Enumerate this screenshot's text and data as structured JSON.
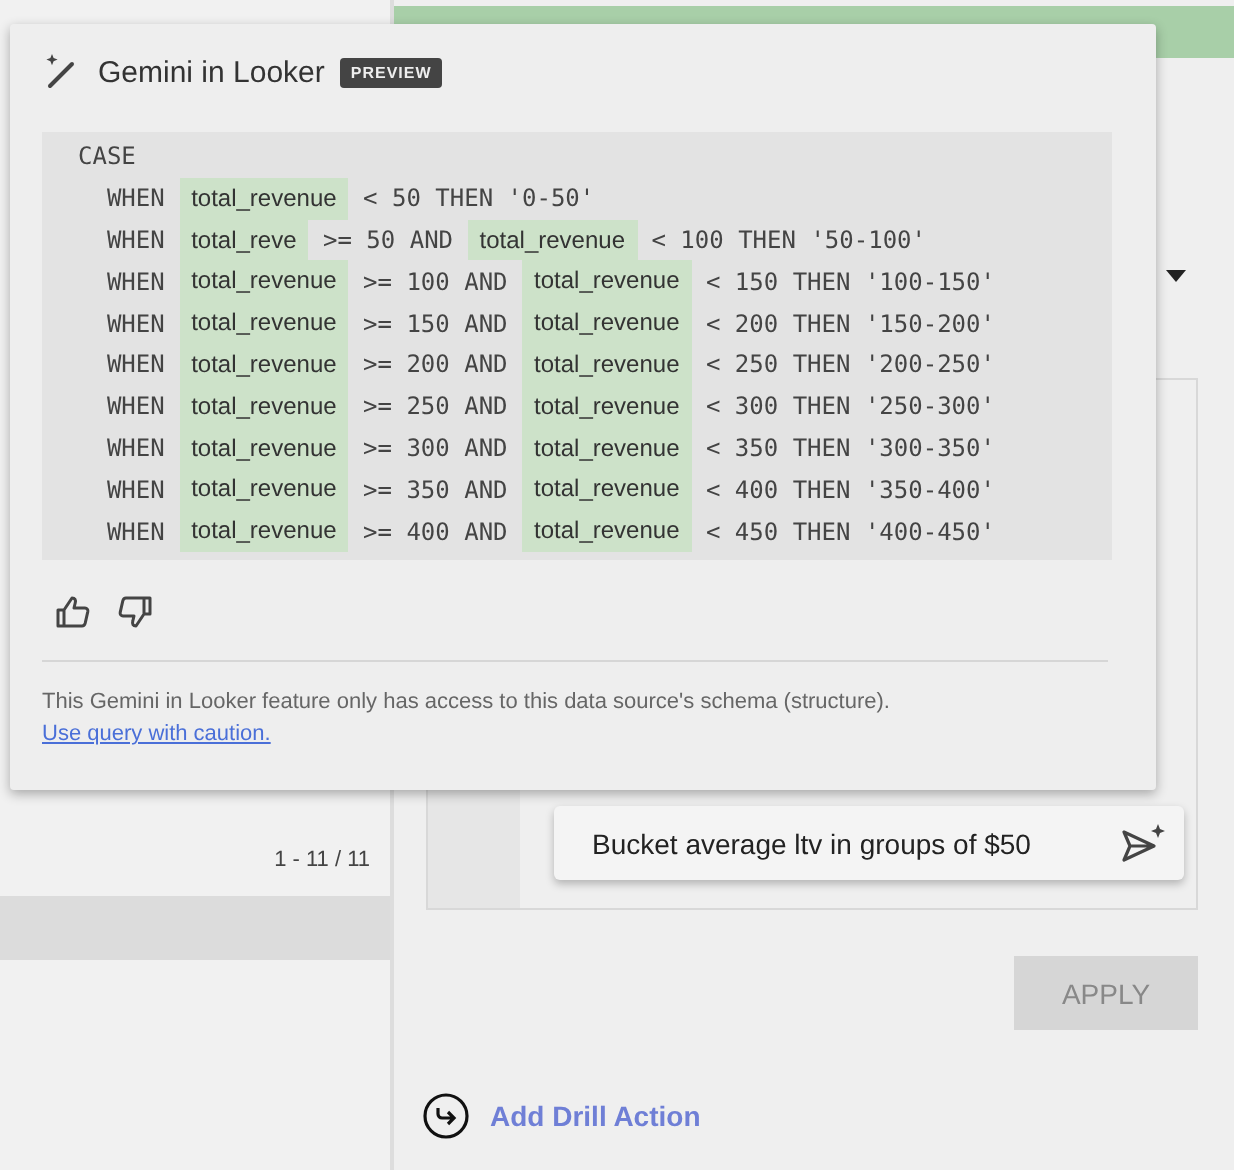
{
  "popup": {
    "title": "Gemini in Looker",
    "badge": "PREVIEW",
    "code": [
      [
        {
          "kind": "code",
          "text": "CASE"
        }
      ],
      [
        {
          "kind": "code",
          "text": "  WHEN "
        },
        {
          "kind": "field",
          "text": "total_revenue"
        },
        {
          "kind": "code",
          "text": " < 50 THEN '0-50'"
        }
      ],
      [
        {
          "kind": "code",
          "text": "  WHEN "
        },
        {
          "kind": "field",
          "text": "total_reve"
        },
        {
          "kind": "code",
          "text": " >= 50 AND "
        },
        {
          "kind": "field",
          "text": "total_revenue"
        },
        {
          "kind": "code",
          "text": " < 100 THEN '50-100'"
        }
      ],
      [
        {
          "kind": "code",
          "text": "  WHEN "
        },
        {
          "kind": "field",
          "text": "total_revenue"
        },
        {
          "kind": "code",
          "text": " >= 100 AND "
        },
        {
          "kind": "field",
          "text": "total_revenue"
        },
        {
          "kind": "code",
          "text": " < 150 THEN '100-150'"
        }
      ],
      [
        {
          "kind": "code",
          "text": "  WHEN "
        },
        {
          "kind": "field",
          "text": "total_revenue"
        },
        {
          "kind": "code",
          "text": " >= 150 AND "
        },
        {
          "kind": "field",
          "text": "total_revenue"
        },
        {
          "kind": "code",
          "text": " < 200 THEN '150-200'"
        }
      ],
      [
        {
          "kind": "code",
          "text": "  WHEN "
        },
        {
          "kind": "field",
          "text": "total_revenue"
        },
        {
          "kind": "code",
          "text": " >= 200 AND "
        },
        {
          "kind": "field",
          "text": "total_revenue"
        },
        {
          "kind": "code",
          "text": " < 250 THEN '200-250'"
        }
      ],
      [
        {
          "kind": "code",
          "text": "  WHEN "
        },
        {
          "kind": "field",
          "text": "total_revenue"
        },
        {
          "kind": "code",
          "text": " >= 250 AND "
        },
        {
          "kind": "field",
          "text": "total_revenue"
        },
        {
          "kind": "code",
          "text": " < 300 THEN '250-300'"
        }
      ],
      [
        {
          "kind": "code",
          "text": "  WHEN "
        },
        {
          "kind": "field",
          "text": "total_revenue"
        },
        {
          "kind": "code",
          "text": " >= 300 AND "
        },
        {
          "kind": "field",
          "text": "total_revenue"
        },
        {
          "kind": "code",
          "text": " < 350 THEN '300-350'"
        }
      ],
      [
        {
          "kind": "code",
          "text": "  WHEN "
        },
        {
          "kind": "field",
          "text": "total_revenue"
        },
        {
          "kind": "code",
          "text": " >= 350 AND "
        },
        {
          "kind": "field",
          "text": "total_revenue"
        },
        {
          "kind": "code",
          "text": " < 400 THEN '350-400'"
        }
      ],
      [
        {
          "kind": "code",
          "text": "  WHEN "
        },
        {
          "kind": "field",
          "text": "total_revenue"
        },
        {
          "kind": "code",
          "text": " >= 400 AND "
        },
        {
          "kind": "field",
          "text": "total_revenue"
        },
        {
          "kind": "code",
          "text": " < 450 THEN '400-450'"
        }
      ]
    ],
    "disclaimer": "This Gemini in Looker feature only has access to this data source's schema (structure). ",
    "disclaimer_link": "Use query with caution."
  },
  "table": {
    "pagination": "1 - 11 / 11"
  },
  "panel": {
    "prompt": "Bucket average ltv in groups of $50",
    "apply": {
      "label": "APPLY",
      "disabled": true
    },
    "drill_link": "Add Drill Action"
  }
}
